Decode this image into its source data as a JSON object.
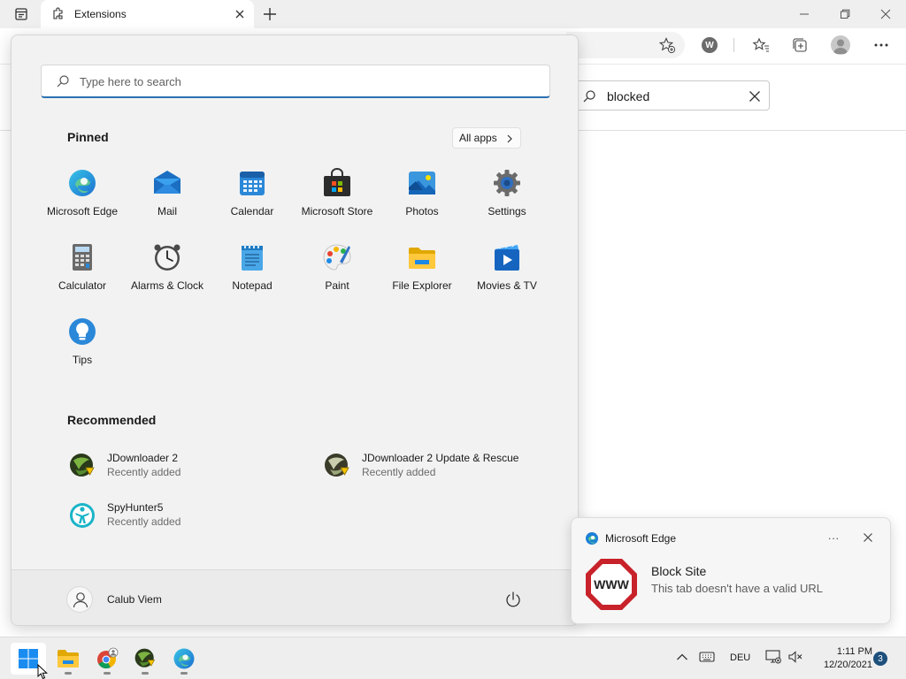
{
  "browser": {
    "tab_title": "Extensions",
    "extensions_search_value": "blocked"
  },
  "start_menu": {
    "search_placeholder": "Type here to search",
    "pinned_title": "Pinned",
    "all_apps_label": "All apps",
    "pinned": [
      {
        "label": "Microsoft Edge",
        "icon": "edge-icon"
      },
      {
        "label": "Mail",
        "icon": "mail-icon"
      },
      {
        "label": "Calendar",
        "icon": "calendar-icon"
      },
      {
        "label": "Microsoft Store",
        "icon": "store-icon"
      },
      {
        "label": "Photos",
        "icon": "photos-icon"
      },
      {
        "label": "Settings",
        "icon": "gear-icon"
      },
      {
        "label": "Calculator",
        "icon": "calculator-icon"
      },
      {
        "label": "Alarms & Clock",
        "icon": "clock-icon"
      },
      {
        "label": "Notepad",
        "icon": "notepad-icon"
      },
      {
        "label": "Paint",
        "icon": "paint-icon"
      },
      {
        "label": "File Explorer",
        "icon": "folder-icon"
      },
      {
        "label": "Movies & TV",
        "icon": "movies-icon"
      },
      {
        "label": "Tips",
        "icon": "lightbulb-icon"
      }
    ],
    "recommended_title": "Recommended",
    "recommended": [
      {
        "title": "JDownloader 2",
        "subtitle": "Recently added",
        "icon": "jdownloader-icon"
      },
      {
        "title": "JDownloader 2 Update & Rescue",
        "subtitle": "Recently added",
        "icon": "jdownloader-icon"
      },
      {
        "title": "SpyHunter5",
        "subtitle": "Recently added",
        "icon": "spyhunter-icon"
      }
    ],
    "user_name": "Calub Viem"
  },
  "notification": {
    "app": "Microsoft Edge",
    "more": "···",
    "title": "Block Site",
    "body": "This tab doesn't have a valid URL",
    "image_text": "WWW"
  },
  "taskbar": {
    "apps": [
      "start-icon",
      "folder-icon",
      "chrome-icon",
      "jdownloader-icon",
      "edge-icon"
    ],
    "language": "DEU",
    "time": "1:11 PM",
    "date": "12/20/2021",
    "notification_count": "3"
  },
  "colors": {
    "accent": "#2b6fb3",
    "start_bg": "#f2f2f2",
    "taskbar_bg": "#eeeeee",
    "stop_red": "#c8222a"
  }
}
